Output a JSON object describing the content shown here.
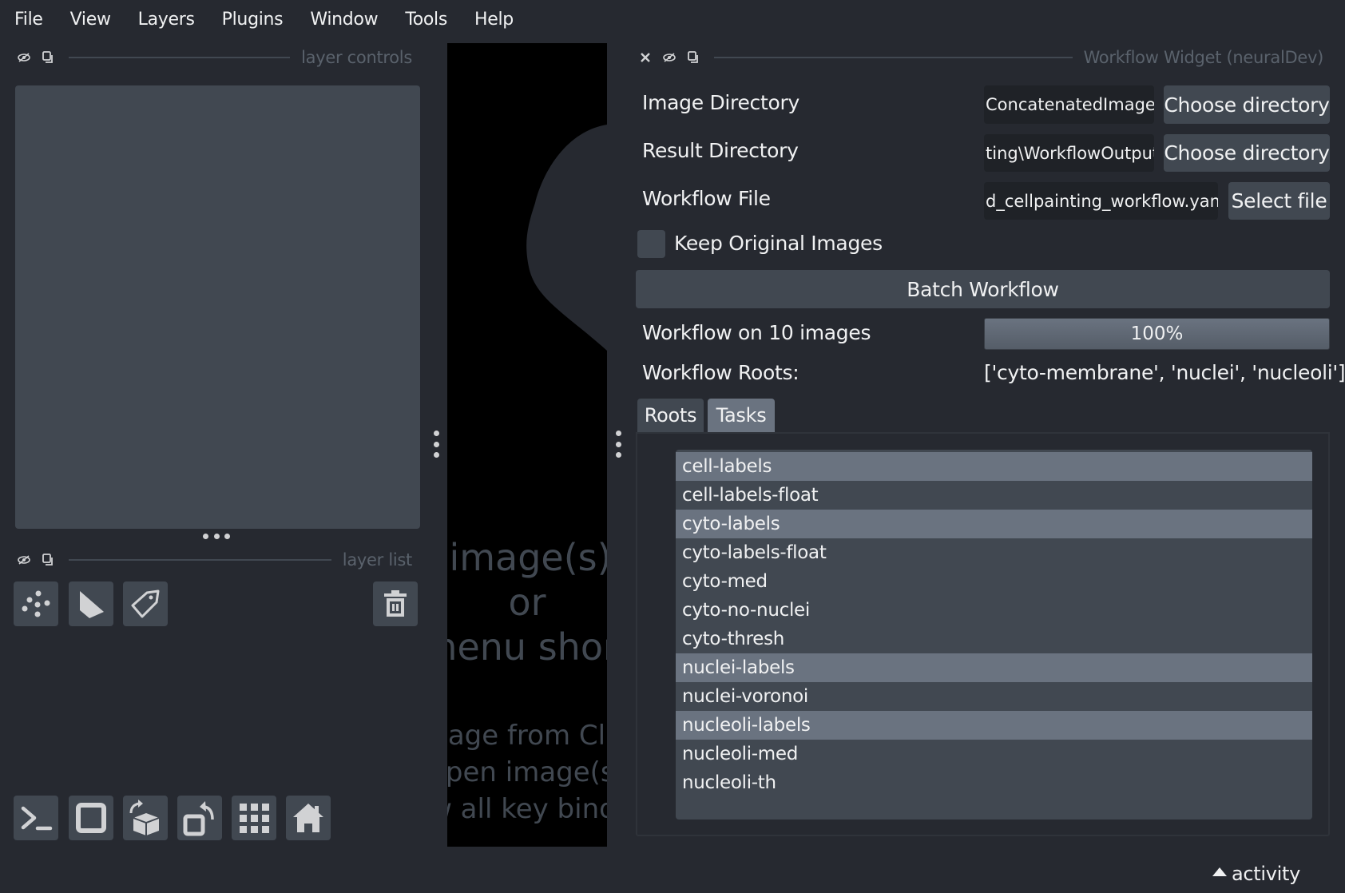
{
  "menu": [
    "File",
    "View",
    "Layers",
    "Plugins",
    "Window",
    "Tools",
    "Help"
  ],
  "left_dock": {
    "layer_controls_title": "layer controls",
    "layer_list_title": "layer list",
    "layer_buttons": [
      {
        "name": "new-points-layer",
        "icon": "points-icon"
      },
      {
        "name": "new-shapes-layer",
        "icon": "shapes-icon"
      },
      {
        "name": "new-labels-layer",
        "icon": "labels-tag-icon"
      }
    ],
    "delete_button_icon": "trash-icon",
    "viewer_buttons": [
      {
        "name": "console",
        "icon": "terminal-icon"
      },
      {
        "name": "ndisplay-toggle",
        "icon": "square-2d-icon"
      },
      {
        "name": "roll-dims",
        "icon": "cube-rotate-icon"
      },
      {
        "name": "transpose-dims",
        "icon": "transpose-icon"
      },
      {
        "name": "grid-mode",
        "icon": "grid-icon"
      },
      {
        "name": "reset-view",
        "icon": "home-icon"
      }
    ]
  },
  "canvas": {
    "welcome_line1": "Drag image(s) here",
    "welcome_line2": "or",
    "welcome_line3": "use menu shortcuts",
    "shortcut1": "New Image from Clipboard",
    "shortcut2": "open image(s)",
    "shortcut3": "show all key bindings"
  },
  "widget": {
    "title": "Workflow Widget (neuralDev)",
    "image_directory": {
      "label": "Image Directory",
      "value": "ConcatenatedImages",
      "button": "Choose directory"
    },
    "result_directory": {
      "label": "Result Directory",
      "value": "ting\\WorkflowOutput",
      "button": "Choose directory"
    },
    "workflow_file": {
      "label": "Workflow File",
      "value": "d_cellpainting_workflow.yaml",
      "button": "Select file"
    },
    "keep_original": {
      "label": "Keep Original Images",
      "checked": false
    },
    "batch_button": "Batch Workflow",
    "progress": {
      "label": "Workflow on 10 images",
      "percent": 100,
      "text": "100%"
    },
    "roots": {
      "label": "Workflow Roots:",
      "value": "['cyto-membrane', 'nuclei', 'nucleoli']"
    },
    "tabs": [
      {
        "label": "Roots",
        "active": false
      },
      {
        "label": "Tasks",
        "active": true
      }
    ],
    "tasks": [
      {
        "label": "cell-labels",
        "selected": true
      },
      {
        "label": "cell-labels-float",
        "selected": false
      },
      {
        "label": "cyto-labels",
        "selected": true
      },
      {
        "label": "cyto-labels-float",
        "selected": false
      },
      {
        "label": "cyto-med",
        "selected": false
      },
      {
        "label": "cyto-no-nuclei",
        "selected": false
      },
      {
        "label": "cyto-thresh",
        "selected": false
      },
      {
        "label": "nuclei-labels",
        "selected": true
      },
      {
        "label": "nuclei-voronoi",
        "selected": false
      },
      {
        "label": "nucleoli-labels",
        "selected": true
      },
      {
        "label": "nucleoli-med",
        "selected": false
      },
      {
        "label": "nucleoli-th",
        "selected": false
      }
    ]
  },
  "status": {
    "activity_label": "activity"
  },
  "colors": {
    "background": "#262930",
    "panel": "#414851",
    "highlight": "#6a7380",
    "text": "#f0f1f2",
    "muted_text": "#5a626c",
    "icon": "#d1d2d4",
    "canvas": "#000000"
  }
}
